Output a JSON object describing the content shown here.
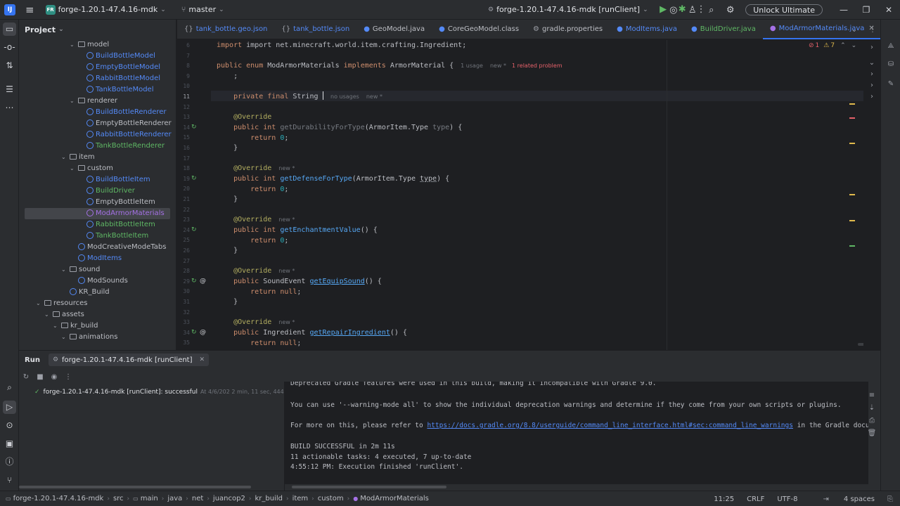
{
  "titlebar": {
    "project_badge": "FR",
    "project_name": "forge-1.20.1-47.4.16-mdk",
    "branch": "master",
    "run_config": "forge-1.20.1-47.4.16-mdk [runClient]",
    "unlock_label": "Unlock Ultimate"
  },
  "project_panel": {
    "title": "Project",
    "tree": [
      {
        "label": "model",
        "kind": "folder",
        "depth": 6,
        "expanded": true
      },
      {
        "label": "BuildBottleModel",
        "kind": "class",
        "depth": 8,
        "color": "blue"
      },
      {
        "label": "EmptyBottleModel",
        "kind": "class",
        "depth": 8,
        "color": "blue"
      },
      {
        "label": "RabbitBottleModel",
        "kind": "class",
        "depth": 8,
        "color": "blue"
      },
      {
        "label": "TankBottleModel",
        "kind": "class",
        "depth": 8,
        "color": "blue"
      },
      {
        "label": "renderer",
        "kind": "folder",
        "depth": 6,
        "expanded": true
      },
      {
        "label": "BuildBottleRenderer",
        "kind": "class",
        "depth": 8,
        "color": "blue"
      },
      {
        "label": "EmptyBottleRenderer",
        "kind": "class",
        "depth": 8,
        "color": "plain"
      },
      {
        "label": "RabbitBottleRenderer",
        "kind": "class",
        "depth": 8,
        "color": "blue"
      },
      {
        "label": "TankBottleRenderer",
        "kind": "class",
        "depth": 8,
        "color": "green"
      },
      {
        "label": "item",
        "kind": "folder",
        "depth": 5,
        "expanded": true
      },
      {
        "label": "custom",
        "kind": "folder",
        "depth": 6,
        "expanded": true
      },
      {
        "label": "BuildBottleItem",
        "kind": "class",
        "depth": 8,
        "color": "blue"
      },
      {
        "label": "BuildDriver",
        "kind": "class",
        "depth": 8,
        "color": "green"
      },
      {
        "label": "EmptyBottleItem",
        "kind": "class",
        "depth": 8,
        "color": "plain"
      },
      {
        "label": "ModArmorMaterials",
        "kind": "enum",
        "depth": 8,
        "color": "violet",
        "selected": true
      },
      {
        "label": "RabbitBottleItem",
        "kind": "class",
        "depth": 8,
        "color": "green"
      },
      {
        "label": "TankBottleItem",
        "kind": "class",
        "depth": 8,
        "color": "green"
      },
      {
        "label": "ModCreativeModeTabs",
        "kind": "class",
        "depth": 7,
        "color": "plain"
      },
      {
        "label": "ModItems",
        "kind": "class",
        "depth": 7,
        "color": "blue"
      },
      {
        "label": "sound",
        "kind": "folder",
        "depth": 5,
        "expanded": true
      },
      {
        "label": "ModSounds",
        "kind": "class",
        "depth": 7,
        "color": "plain"
      },
      {
        "label": "KR_Build",
        "kind": "class",
        "depth": 6,
        "color": "plain"
      },
      {
        "label": "resources",
        "kind": "folder",
        "depth": 2,
        "expanded": true
      },
      {
        "label": "assets",
        "kind": "folder",
        "depth": 3,
        "expanded": true
      },
      {
        "label": "kr_build",
        "kind": "folder",
        "depth": 4,
        "expanded": true
      },
      {
        "label": "animations",
        "kind": "folder",
        "depth": 5,
        "expanded": true
      }
    ]
  },
  "tabs": [
    {
      "label": "tank_bottle.geo.json",
      "icon": "json-icon",
      "color": "blue"
    },
    {
      "label": "tank_bottle.json",
      "icon": "json-icon",
      "color": "blue"
    },
    {
      "label": "GeoModel.java",
      "icon": "class-icon",
      "color": "plain"
    },
    {
      "label": "CoreGeoModel.class",
      "icon": "class-icon",
      "color": "plain"
    },
    {
      "label": "gradle.properties",
      "icon": "gear-icon",
      "color": "plain"
    },
    {
      "label": "ModItems.java",
      "icon": "class-icon",
      "color": "blue"
    },
    {
      "label": "BuildDriver.java",
      "icon": "class-icon",
      "color": "green"
    },
    {
      "label": "ModArmorMaterials.java",
      "icon": "enum-icon",
      "color": "blue",
      "active": true
    }
  ],
  "editor": {
    "errors": "1",
    "warnings": "7",
    "hint_usage": "1 usage",
    "hint_new": "new *",
    "hint_problem": "1 related problem",
    "hint_no_usages": "no usages",
    "line_numbers": [
      "6",
      "7",
      "8",
      "9",
      "10",
      "11",
      "12",
      "13",
      "14",
      "15",
      "16",
      "17",
      "18",
      "19",
      "20",
      "21",
      "22",
      "23",
      "24",
      "25",
      "26",
      "27",
      "28",
      "29",
      "30",
      "31",
      "32",
      "33",
      "34",
      "35"
    ],
    "code": {
      "l6": "import net.minecraft.world.item.crafting.Ingredient;",
      "l8_a": "public enum ",
      "l8_b": "ModArmorMaterials ",
      "l8_c": "implements ",
      "l8_d": "ArmorMaterial {",
      "l9": "    ;",
      "l11_a": "    private final ",
      "l11_b": "String ",
      "override": "    @Override",
      "l14_a": "    public int ",
      "l14_b": "getDurabilityForType",
      "l14_c": "(ArmorItem.Type ",
      "l14_d": "type",
      "l14_e": ") {",
      "ret0_a": "        return ",
      "ret0_b": "0",
      "ret0_c": ";",
      "close": "    }",
      "l19_b": "getDefenseForType",
      "l24_b": "getEnchantmentValue",
      "l24_c": "() {",
      "l29_a": "    public SoundEvent ",
      "l29_b": "getEquipSound",
      "l29_c": "() {",
      "retnull_a": "        return ",
      "retnull_b": "null",
      "retnull_c": ";",
      "l34_a": "    public Ingredient ",
      "l34_b": "getRepairIngredient",
      "l34_c": "() {"
    }
  },
  "run_panel": {
    "title": "Run",
    "tab_label": "forge-1.20.1-47.4.16-mdk [runClient]",
    "tree_item": "forge-1.20.1-47.4.16-mdk [runClient]:",
    "tree_status": "successful",
    "tree_time": "At 4/6/202 2 min, 11 sec, 444 ms",
    "console": {
      "cut_line": "Deprecated Gradle features were used in this build, making it incompatible with Gradle 9.0.",
      "l1": "You can use '--warning-mode all' to show the individual deprecation warnings and determine if they come from your own scripts or plugins.",
      "l2_a": "For more on this, please refer to ",
      "l2_link": "https://docs.gradle.org/8.8/userguide/command_line_interface.html#sec:command_line_warnings",
      "l2_b": " in the Gradle documentation.",
      "l3": "BUILD SUCCESSFUL in 2m 11s",
      "l4": "11 actionable tasks: 4 executed, 7 up-to-date",
      "l5": "4:55:12 PM: Execution finished 'runClient'."
    }
  },
  "statusbar": {
    "breadcrumbs": [
      "forge-1.20.1-47.4.16-mdk",
      "src",
      "main",
      "java",
      "net",
      "juancop2",
      "kr_build",
      "item",
      "custom",
      "ModArmorMaterials"
    ],
    "position": "11:25",
    "line_sep": "CRLF",
    "encoding": "UTF-8",
    "indent": "4 spaces"
  },
  "colors": {
    "accent": "#3574f0",
    "success": "#5fb865",
    "error": "#e5616a",
    "warning": "#e0b94c"
  }
}
